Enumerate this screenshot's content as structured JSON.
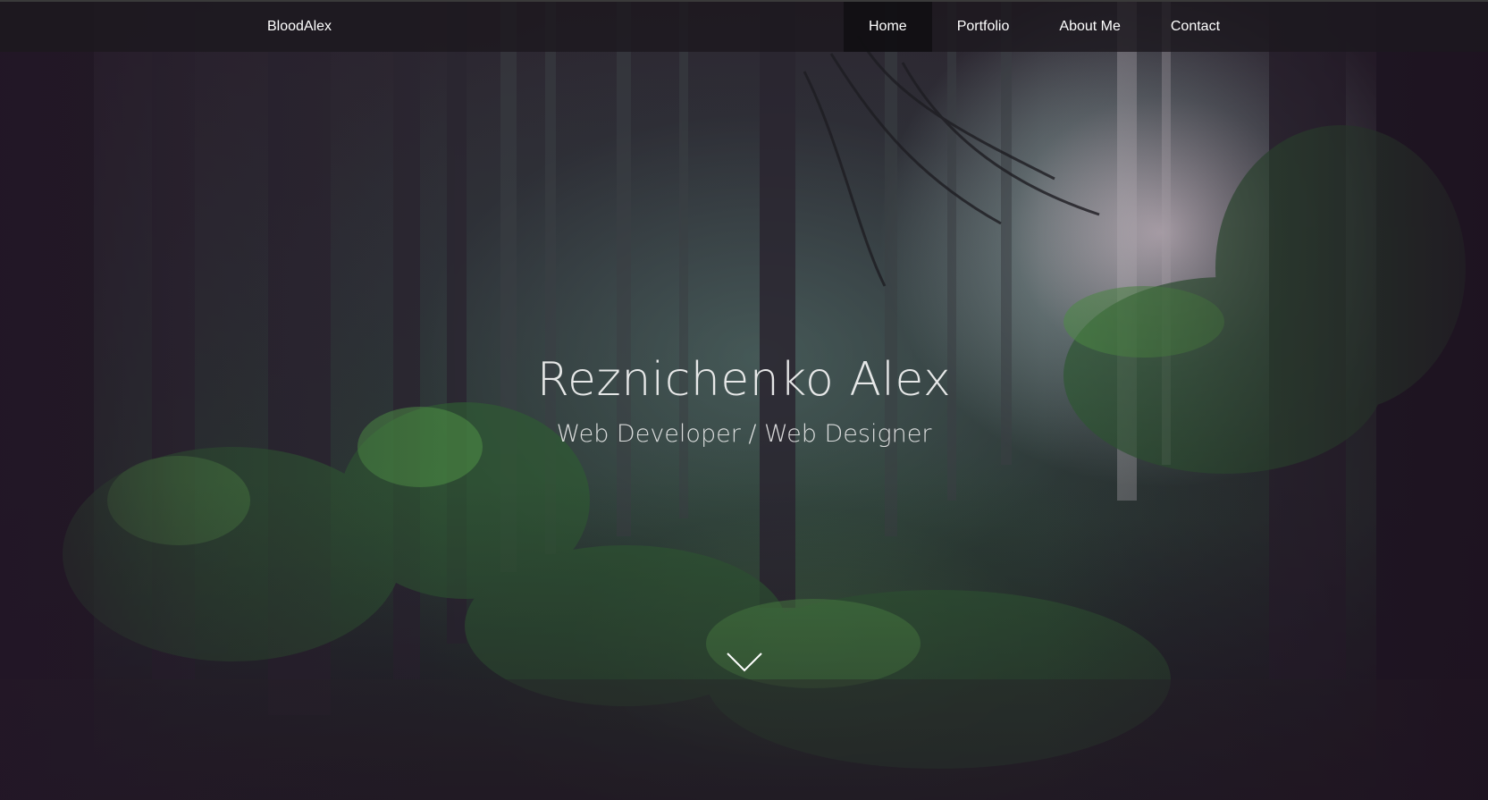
{
  "navbar": {
    "brand": "BloodAlex",
    "links": [
      {
        "label": "Home",
        "active": true
      },
      {
        "label": "Portfolio",
        "active": false
      },
      {
        "label": "About Me",
        "active": false
      },
      {
        "label": "Contact",
        "active": false
      }
    ]
  },
  "hero": {
    "title": "Reznichenko Alex",
    "subtitle": "Web Developer / Web Designer",
    "background": "forest-photo",
    "scroll_icon": "chevron-down-icon"
  },
  "colors": {
    "nav_bg": "#1c181e",
    "text": "#ffffff"
  }
}
